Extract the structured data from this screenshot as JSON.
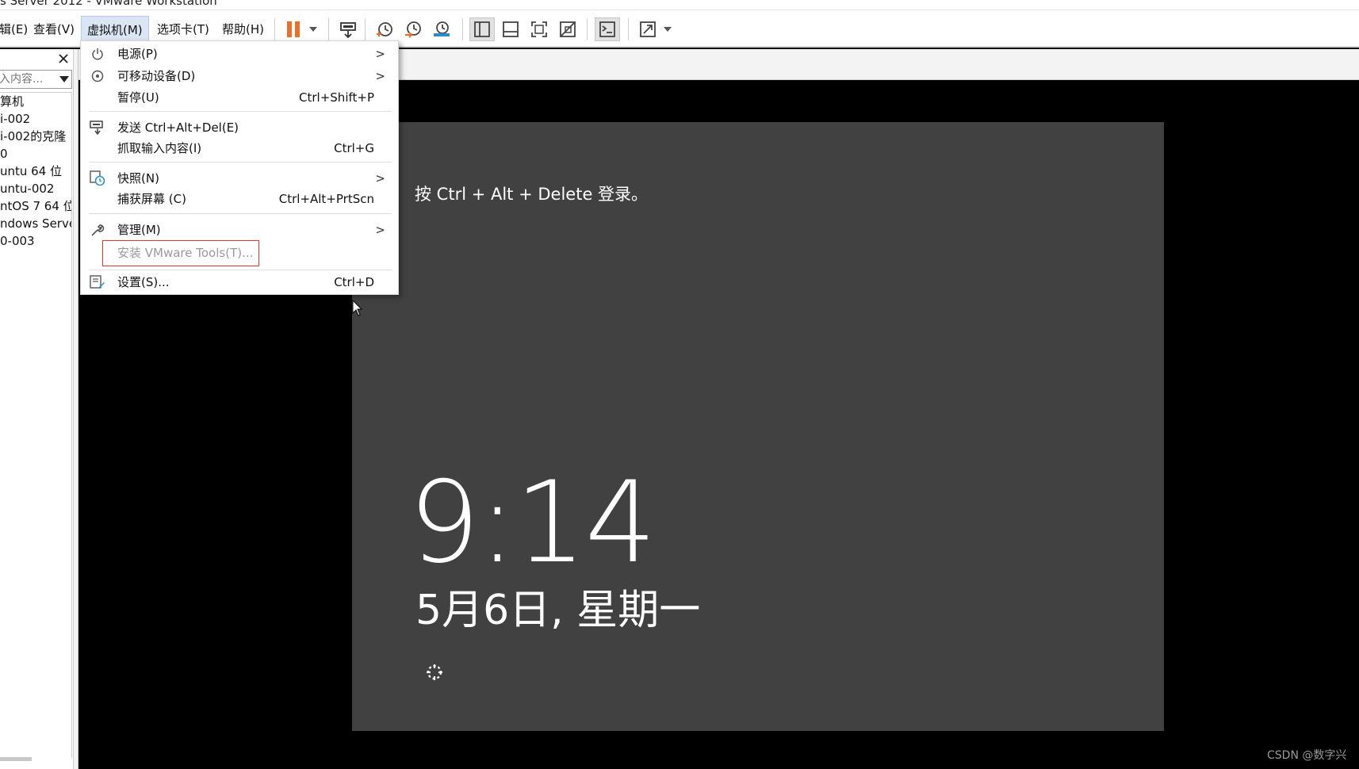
{
  "window": {
    "title": "s Server 2012 - VMware Workstation"
  },
  "menubar": {
    "items": [
      {
        "id": "edit",
        "label": "辑(E)"
      },
      {
        "id": "view",
        "label": "查看(V)"
      },
      {
        "id": "vm",
        "label": "虚拟机(M)"
      },
      {
        "id": "tabs",
        "label": "选项卡(T)"
      },
      {
        "id": "help",
        "label": "帮助(H)"
      }
    ]
  },
  "toolbar": {
    "accent": "#e8702a",
    "buttons": [
      {
        "name": "pause-icon"
      },
      {
        "name": "send-ctrl-alt-del-icon"
      },
      {
        "name": "take-snapshot-icon"
      },
      {
        "name": "revert-snapshot-icon"
      },
      {
        "name": "snapshot-manager-icon"
      },
      {
        "name": "show-library-icon"
      },
      {
        "name": "thumbnail-bar-icon"
      },
      {
        "name": "full-screen-icon"
      },
      {
        "name": "unity-icon"
      },
      {
        "name": "console-view-icon"
      },
      {
        "name": "stretch-guest-icon"
      }
    ]
  },
  "sidebar": {
    "search_placeholder": "入内容...",
    "items": [
      {
        "label": "算机"
      },
      {
        "label": "i-002"
      },
      {
        "label": "i-002的克隆"
      },
      {
        "label": "0"
      },
      {
        "label": "untu 64 位"
      },
      {
        "label": "untu-002"
      },
      {
        "label": "ntOS 7 64 位"
      },
      {
        "label": "ndows Server"
      },
      {
        "label": "0-003"
      }
    ]
  },
  "vm_menu": {
    "items": [
      {
        "label": "电源(P)",
        "shortcut": "",
        "submenu": true,
        "icon": "power-icon"
      },
      {
        "label": "可移动设备(D)",
        "shortcut": "",
        "submenu": true,
        "icon": "removable-device-icon"
      },
      {
        "label": "暂停(U)",
        "shortcut": "Ctrl+Shift+P",
        "submenu": false,
        "icon": ""
      },
      {
        "label": "发送 Ctrl+Alt+Del(E)",
        "shortcut": "",
        "submenu": false,
        "icon": "send-keys-icon"
      },
      {
        "label": "抓取输入内容(I)",
        "shortcut": "Ctrl+G",
        "submenu": false,
        "icon": ""
      },
      {
        "label": "快照(N)",
        "shortcut": "",
        "submenu": true,
        "icon": "snapshot-icon"
      },
      {
        "label": "捕获屏幕 (C)",
        "shortcut": "Ctrl+Alt+PrtScn",
        "submenu": false,
        "icon": ""
      },
      {
        "label": "管理(M)",
        "shortcut": "",
        "submenu": true,
        "icon": "wrench-icon"
      },
      {
        "label": "安装 VMware Tools(T)...",
        "shortcut": "",
        "submenu": false,
        "icon": "",
        "disabled": true,
        "highlight_color": "#e0362c"
      },
      {
        "label": "设置(S)...",
        "shortcut": "Ctrl+D",
        "submenu": false,
        "icon": "settings-icon"
      }
    ],
    "submenu_arrow": ">"
  },
  "vm_screen": {
    "background": "#414141",
    "login_hint": "按 Ctrl + Alt + Delete 登录。",
    "time": "9:14",
    "date": "5月6日, 星期一"
  },
  "watermark": "CSDN @数字兴"
}
